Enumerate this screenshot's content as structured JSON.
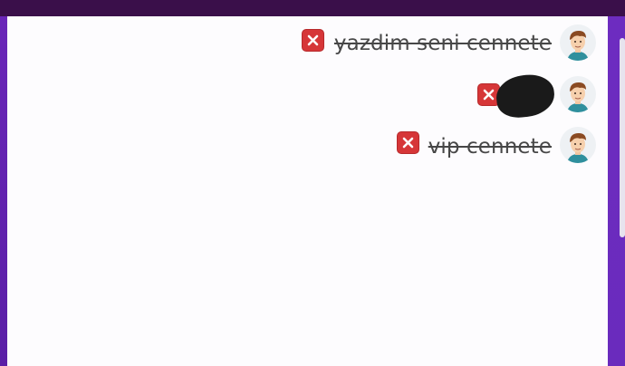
{
  "messages": [
    {
      "text": "yazdim seni cennete",
      "status": "deleted",
      "avatar_icon": "user-avatar-icon",
      "action_icon": "close-icon"
    },
    {
      "text": "",
      "status": "deleted",
      "redacted": true,
      "avatar_icon": "user-avatar-icon",
      "action_icon": "close-icon"
    },
    {
      "text": "vip cennete",
      "status": "deleted",
      "avatar_icon": "user-avatar-icon",
      "action_icon": "close-icon"
    }
  ],
  "colors": {
    "top_bar": "#3a0f4a",
    "frame_purple": "#6a2bbd",
    "panel_bg": "#fdfcfe",
    "delete_red": "#d63638",
    "text": "#474747"
  }
}
